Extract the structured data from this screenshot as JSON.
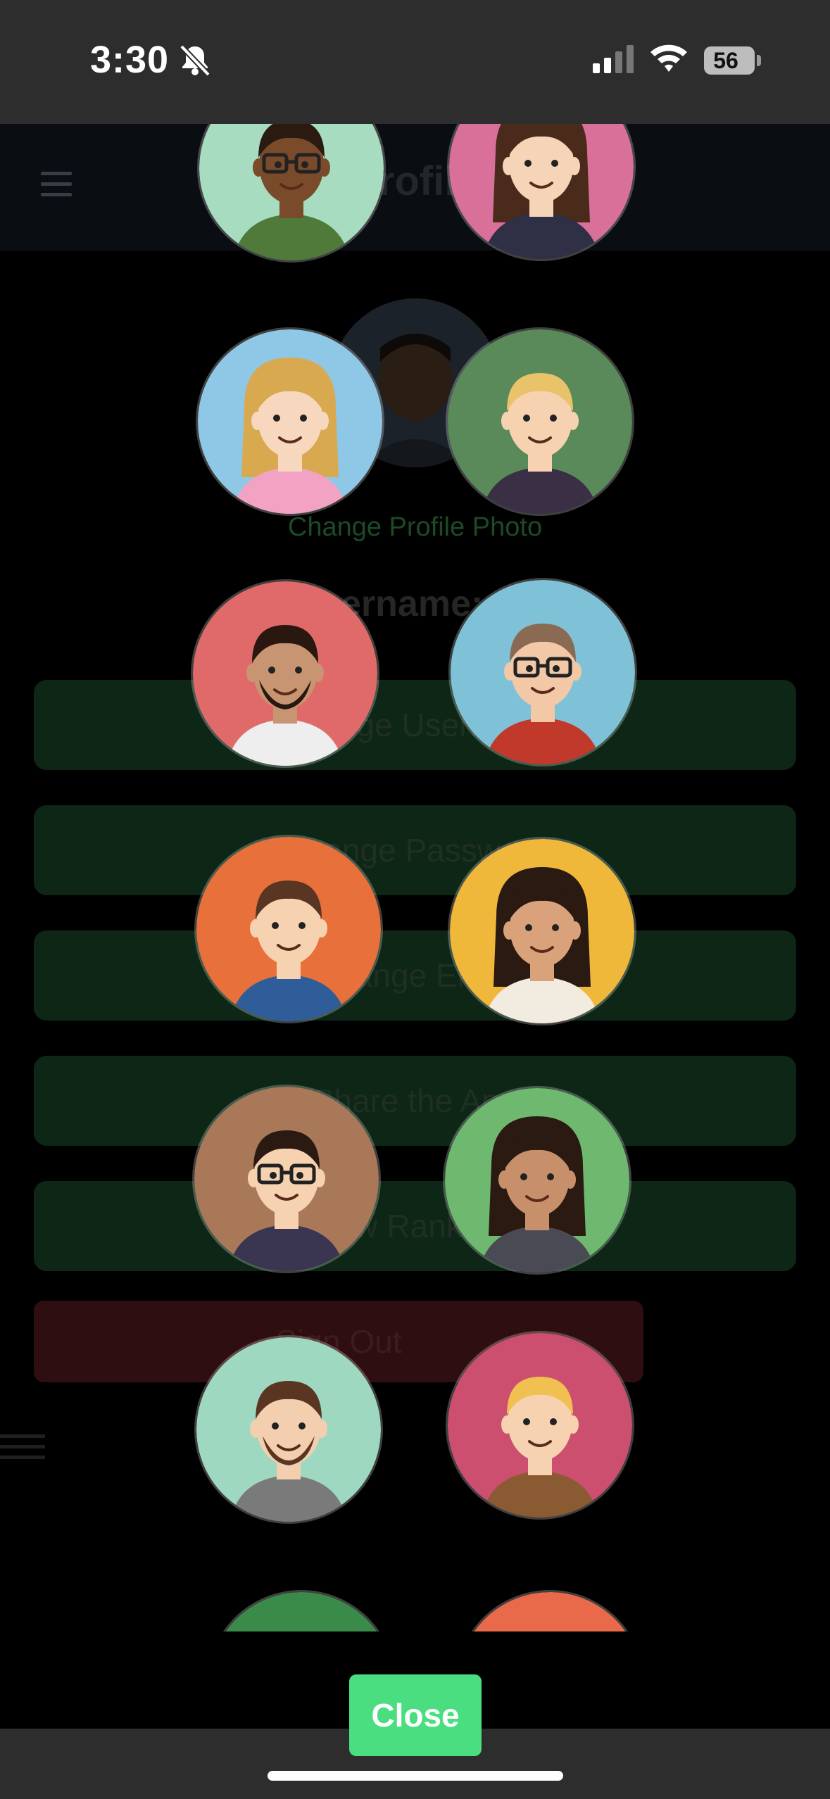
{
  "status_bar": {
    "time": "3:30",
    "battery": "56",
    "icons": [
      "bell-slash-icon",
      "signal-icon",
      "wifi-icon",
      "battery-icon"
    ]
  },
  "background_page": {
    "title": "Profile",
    "change_photo_label": "Change Profile Photo",
    "username_label": "Username: da",
    "buttons": [
      {
        "label": "Change Username"
      },
      {
        "label": "Change Password"
      },
      {
        "label": "Change Email"
      },
      {
        "label": "Share the App"
      },
      {
        "label": "View Rankings"
      }
    ],
    "sign_out_label": "Sign Out"
  },
  "avatar_picker": {
    "avatars": [
      {
        "name": "man-glasses-green",
        "bg": "#a7dcc0",
        "skin": "#7a4b2a",
        "hair": "#2b1a10",
        "shirt": "#4f7a3a",
        "glasses": true,
        "long_hair": false,
        "beard": false
      },
      {
        "name": "woman-pink",
        "bg": "#d8709a",
        "skin": "#f5d4b8",
        "hair": "#4a2a1a",
        "shirt": "#2f2f45",
        "glasses": false,
        "long_hair": true,
        "beard": false
      },
      {
        "name": "woman-blonde-blue",
        "bg": "#8ec8e6",
        "skin": "#f7d7bd",
        "hair": "#d9a94f",
        "shirt": "#f2a3c4",
        "glasses": false,
        "long_hair": true,
        "beard": false
      },
      {
        "name": "man-blonde-green",
        "bg": "#5a8a5a",
        "skin": "#f6d2b0",
        "hair": "#e8c36a",
        "shirt": "#3a2f45",
        "glasses": false,
        "long_hair": false,
        "beard": false
      },
      {
        "name": "man-goatee-red",
        "bg": "#e06a6a",
        "skin": "#c89572",
        "hair": "#2a1810",
        "shirt": "#eeeeee",
        "glasses": false,
        "long_hair": false,
        "beard": true
      },
      {
        "name": "woman-glasses-blue",
        "bg": "#7fc2d8",
        "skin": "#f2c8a6",
        "hair": "#8a6a52",
        "shirt": "#c0392b",
        "glasses": true,
        "long_hair": false,
        "beard": false
      },
      {
        "name": "man-orange",
        "bg": "#e8703a",
        "skin": "#f6d2b0",
        "hair": "#5a3622",
        "shirt": "#2f5d9a",
        "glasses": false,
        "long_hair": false,
        "beard": false
      },
      {
        "name": "woman-yellow",
        "bg": "#f0b83a",
        "skin": "#d9a27a",
        "hair": "#2a1a12",
        "shirt": "#f2ece0",
        "glasses": false,
        "long_hair": true,
        "beard": false
      },
      {
        "name": "man-glasses-brown",
        "bg": "#a87858",
        "skin": "#f6d2b0",
        "hair": "#2a1a12",
        "shirt": "#3a3550",
        "glasses": true,
        "long_hair": false,
        "beard": false
      },
      {
        "name": "woman-green",
        "bg": "#6fb86f",
        "skin": "#c8906a",
        "hair": "#2a1a12",
        "shirt": "#4a4a55",
        "glasses": false,
        "long_hair": true,
        "beard": false
      },
      {
        "name": "man-beard-mint",
        "bg": "#9fd8c0",
        "skin": "#f3cfb0",
        "hair": "#5a3622",
        "shirt": "#7a7a7a",
        "glasses": false,
        "long_hair": false,
        "beard": true
      },
      {
        "name": "woman-rose",
        "bg": "#cc4f70",
        "skin": "#f6d2b0",
        "hair": "#f0c050",
        "shirt": "#8a5a32",
        "glasses": false,
        "long_hair": false,
        "beard": false
      },
      {
        "name": "avatar-partial-1",
        "bg": "#3a8a4a",
        "skin": "#e8703a",
        "hair": "#e8703a",
        "shirt": "#3a8a4a",
        "glasses": false,
        "long_hair": false,
        "beard": false
      },
      {
        "name": "avatar-partial-2",
        "bg": "#e86a4a",
        "skin": "#3a8ab8",
        "hair": "#3a8ab8",
        "shirt": "#e86a4a",
        "glasses": false,
        "long_hair": false,
        "beard": false
      }
    ]
  },
  "close_button_label": "Close"
}
